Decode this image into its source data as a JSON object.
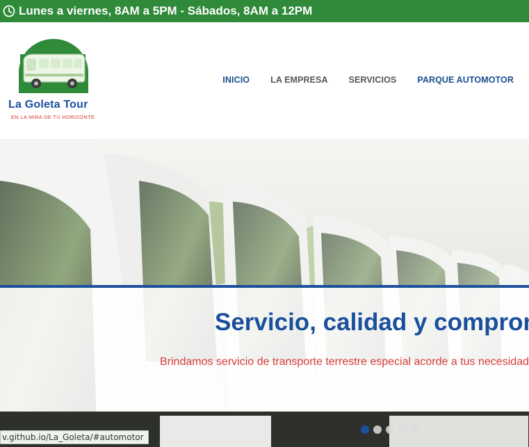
{
  "topbar": {
    "icon": "clock-icon",
    "hours": "Lunes a viernes, 8AM a 5PM - Sábados, 8AM a 12PM"
  },
  "brand": {
    "name": "La Goleta Tour",
    "tagline": "EN LA MIRA DE TU HORIZONTE",
    "colors": {
      "green": "#2f8a3a",
      "blue": "#1a4f9c",
      "red": "#d63b3b"
    }
  },
  "nav": {
    "items": [
      {
        "label": "INICIO"
      },
      {
        "label": "LA EMPRESA"
      },
      {
        "label": "SERVICIOS"
      },
      {
        "label": "PARQUE AUTOMOTOR"
      }
    ]
  },
  "hero": {
    "title": "Servicio, calidad y compromiso",
    "subtitle": "Brindamos servicio de transporte terrestre especial acorde a tus necesidades",
    "slides": 5,
    "active_slide": 1
  },
  "status_bar": {
    "url": "v.github.io/La_Goleta/#automotor"
  }
}
